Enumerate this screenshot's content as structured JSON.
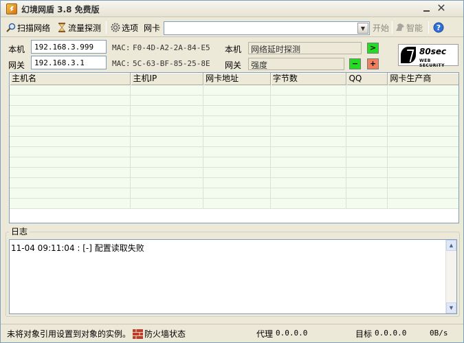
{
  "window": {
    "title": "幻境网盾 3.8 免费版",
    "controls": {
      "minimize": "—",
      "close": "✕"
    }
  },
  "toolbar": {
    "scan_label": "扫描网络",
    "traffic_label": "流量探测",
    "options_label": "选项",
    "nic_label": "网卡",
    "nic_value": "",
    "start_label": "开始",
    "smart_label": "智能",
    "help_icon": "help-icon"
  },
  "info": {
    "local_label": "本机",
    "local_ip": "192.168.3.999",
    "local_mac_label": "MAC:",
    "local_mac": "F0-4D-A2-2A-84-E5",
    "gateway_label": "网关",
    "gateway_ip": "192.168.3.1",
    "gateway_mac_label": "MAC:",
    "gateway_mac": "5C-63-BF-85-25-8E",
    "right_local_label": "本机",
    "latency_text": "网络延时探测",
    "right_gateway_label": "网关",
    "strength_text": "强度",
    "go_button": ">",
    "minus_button": "−",
    "plus_button": "+"
  },
  "logo": {
    "name": "80sec",
    "sub": "WEB SECURITY"
  },
  "table": {
    "columns": [
      "主机名",
      "主机IP",
      "网卡地址",
      "字节数",
      "QQ",
      "网卡生产商"
    ],
    "row_count": 12
  },
  "log": {
    "legend": "日志",
    "lines": [
      "11-04 09:11:04 : [-] 配置读取失败"
    ]
  },
  "status": {
    "message": "未将对象引用设置到对象的实例。",
    "firewall_label": "防火墙状态",
    "proxy_label": "代理",
    "proxy_value": "0.0.0.0",
    "target_label": "目标",
    "target_value": "0.0.0.0",
    "rate": "0B/s"
  },
  "colors": {
    "window_bg": "#ece9d8",
    "row_bg": "#f3fcef",
    "go_button": "#22dd22",
    "plus_button": "#f08060"
  }
}
